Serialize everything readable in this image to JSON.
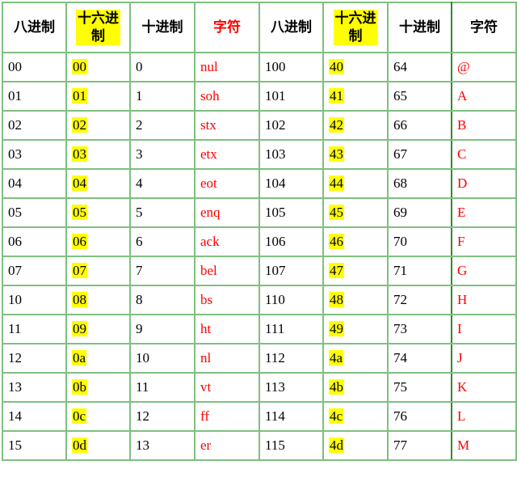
{
  "table": {
    "headers": [
      "八进制",
      "十六进制",
      "十进制",
      "字符",
      "八进制",
      "十六进制",
      "十进制",
      "字符"
    ],
    "rows": [
      {
        "oct1": "00",
        "hex1": "00",
        "dec1": "0",
        "chr1": "nul",
        "oct2": "100",
        "hex2": "40",
        "dec2": "64",
        "chr2": "@"
      },
      {
        "oct1": "01",
        "hex1": "01",
        "dec1": "1",
        "chr1": "soh",
        "oct2": "101",
        "hex2": "41",
        "dec2": "65",
        "chr2": "A"
      },
      {
        "oct1": "02",
        "hex1": "02",
        "dec1": "2",
        "chr1": "stx",
        "oct2": "102",
        "hex2": "42",
        "dec2": "66",
        "chr2": "B"
      },
      {
        "oct1": "03",
        "hex1": "03",
        "dec1": "3",
        "chr1": "etx",
        "oct2": "103",
        "hex2": "43",
        "dec2": "67",
        "chr2": "C"
      },
      {
        "oct1": "04",
        "hex1": "04",
        "dec1": "4",
        "chr1": "eot",
        "oct2": "104",
        "hex2": "44",
        "dec2": "68",
        "chr2": "D"
      },
      {
        "oct1": "05",
        "hex1": "05",
        "dec1": "5",
        "chr1": "enq",
        "oct2": "105",
        "hex2": "45",
        "dec2": "69",
        "chr2": "E"
      },
      {
        "oct1": "06",
        "hex1": "06",
        "dec1": "6",
        "chr1": "ack",
        "oct2": "106",
        "hex2": "46",
        "dec2": "70",
        "chr2": "F"
      },
      {
        "oct1": "07",
        "hex1": "07",
        "dec1": "7",
        "chr1": "bel",
        "oct2": "107",
        "hex2": "47",
        "dec2": "71",
        "chr2": "G"
      },
      {
        "oct1": "10",
        "hex1": "08",
        "dec1": "8",
        "chr1": "bs",
        "oct2": "110",
        "hex2": "48",
        "dec2": "72",
        "chr2": "H"
      },
      {
        "oct1": "11",
        "hex1": "09",
        "dec1": "9",
        "chr1": "ht",
        "oct2": "111",
        "hex2": "49",
        "dec2": "73",
        "chr2": "I"
      },
      {
        "oct1": "12",
        "hex1": "0a",
        "dec1": "10",
        "chr1": "nl",
        "oct2": "112",
        "hex2": "4a",
        "dec2": "74",
        "chr2": "J"
      },
      {
        "oct1": "13",
        "hex1": "0b",
        "dec1": "11",
        "chr1": "vt",
        "oct2": "113",
        "hex2": "4b",
        "dec2": "75",
        "chr2": "K"
      },
      {
        "oct1": "14",
        "hex1": "0c",
        "dec1": "12",
        "chr1": "ff",
        "oct2": "114",
        "hex2": "4c",
        "dec2": "76",
        "chr2": "L"
      },
      {
        "oct1": "15",
        "hex1": "0d",
        "dec1": "13",
        "chr1": "er",
        "oct2": "115",
        "hex2": "4d",
        "dec2": "77",
        "chr2": "M"
      }
    ],
    "colors": {
      "border": "#7fc07f",
      "border_dark": "#2e8b2e",
      "highlight": "#ffff00",
      "char_text": "#ff0000"
    }
  }
}
